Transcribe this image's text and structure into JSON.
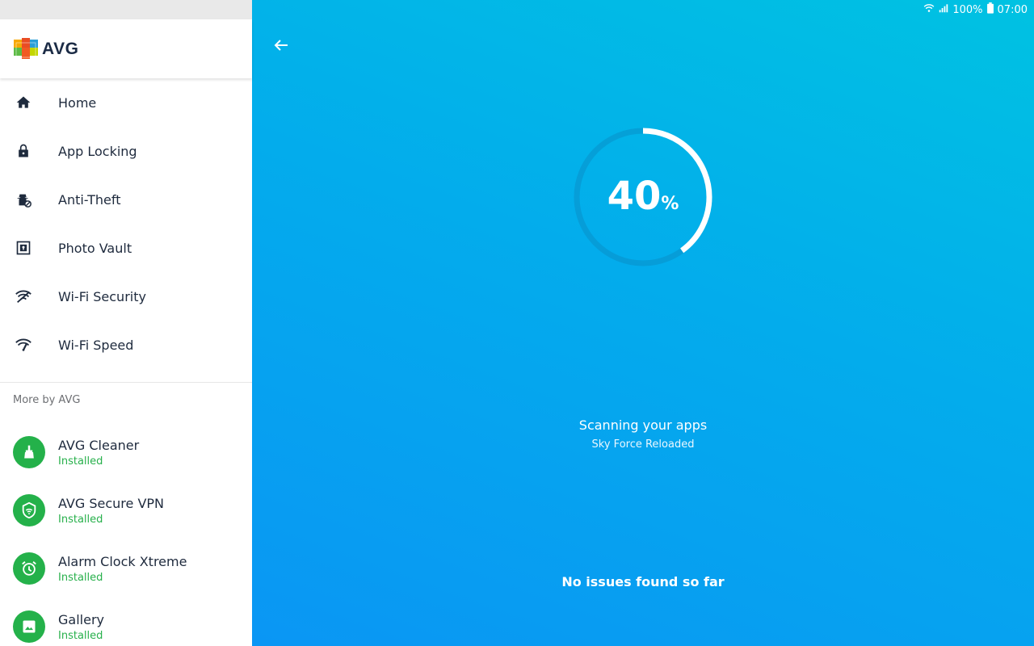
{
  "status_bar": {
    "battery": "100%",
    "time": "07:00"
  },
  "brand": {
    "name": "AVG"
  },
  "nav": {
    "items": [
      {
        "label": "Home",
        "icon": "home-icon"
      },
      {
        "label": "App Locking",
        "icon": "lock-icon"
      },
      {
        "label": "Anti-Theft",
        "icon": "anti-theft-icon"
      },
      {
        "label": "Photo Vault",
        "icon": "photo-vault-icon"
      },
      {
        "label": "Wi-Fi Security",
        "icon": "wifi-security-icon"
      },
      {
        "label": "Wi-Fi Speed",
        "icon": "wifi-speed-icon"
      }
    ]
  },
  "more": {
    "header": "More by AVG",
    "apps": [
      {
        "name": "AVG Cleaner",
        "status": "Installed",
        "icon": "broom-icon"
      },
      {
        "name": "AVG Secure VPN",
        "status": "Installed",
        "icon": "vpn-icon"
      },
      {
        "name": "Alarm Clock Xtreme",
        "status": "Installed",
        "icon": "alarm-clock-icon"
      },
      {
        "name": "Gallery",
        "status": "Installed",
        "icon": "gallery-icon"
      }
    ]
  },
  "scan": {
    "progress_value": "40",
    "progress_symbol": "%",
    "progress_fraction": 0.4,
    "title": "Scanning your apps",
    "current_app": "Sky Force Reloaded",
    "result": "No issues found so far"
  },
  "colors": {
    "accent_green": "#27b04b",
    "main_gradient_top": "#00c2e2",
    "main_gradient_bottom": "#0a96f4",
    "text_dark": "#1e2a3d"
  }
}
